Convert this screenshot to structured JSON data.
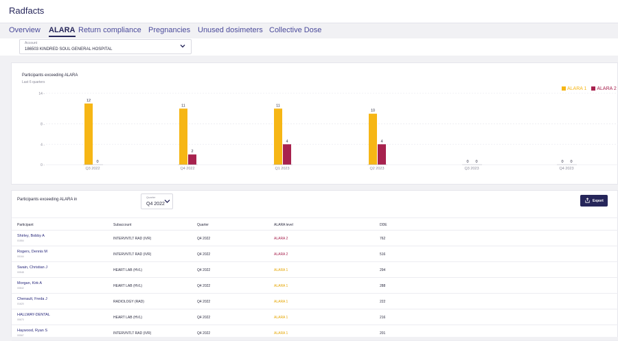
{
  "app": {
    "title": "Radfacts"
  },
  "tabs": [
    {
      "label": "Overview",
      "active": false
    },
    {
      "label": "ALARA",
      "active": true
    },
    {
      "label": "Return compliance",
      "active": false
    },
    {
      "label": "Pregnancies",
      "active": false
    },
    {
      "label": "Unused dosimeters",
      "active": false
    },
    {
      "label": "Collective Dose",
      "active": false
    }
  ],
  "account": {
    "caption": "Account",
    "value": "186503 KINDRED SOUL GENERAL HOSPITAL",
    "icon": "chevron-down-icon"
  },
  "chart_data": {
    "type": "bar",
    "title": "Participants exceeding ALARA",
    "subtitle": "Last 6 quarters",
    "categories": [
      "Q3 2022",
      "Q4 2022",
      "Q1 2023",
      "Q2 2023",
      "Q3 2023",
      "Q4 2023"
    ],
    "series": [
      {
        "name": "ALARA 1",
        "color": "#f6b615",
        "values": [
          12,
          11,
          11,
          10,
          0,
          0
        ]
      },
      {
        "name": "ALARA 2",
        "color": "#a7224e",
        "values": [
          0,
          2,
          4,
          4,
          0,
          0
        ]
      }
    ],
    "yticks": [
      0,
      4,
      8,
      14
    ],
    "ylim": [
      0,
      14
    ],
    "grid": true,
    "legend_position": "top-right"
  },
  "table": {
    "title": "Participants exceeding ALARA in",
    "quarter_caption": "Quarter",
    "quarter_value": "Q4 2022",
    "quarter_icon": "chevron-down-icon",
    "export_label": "Export",
    "export_icon": "upload-icon",
    "columns": [
      "Participant",
      "Subaccount",
      "Quarter",
      "ALARA level",
      "DDE"
    ],
    "rows": [
      {
        "name": "Shirley, Bobby A",
        "id": "01554",
        "subaccount": "INTERVNTLT RAD (IVR)",
        "quarter": "Q4 2022",
        "level": "ALARA 2",
        "dde": "762"
      },
      {
        "name": "Rogers, Dennis M",
        "id": "00164",
        "subaccount": "INTERVNTLT RAD (IVR)",
        "quarter": "Q4 2022",
        "level": "ALARA 2",
        "dde": "516"
      },
      {
        "name": "Swain, Christian J",
        "id": "00548",
        "subaccount": "HEART LAB (HVL)",
        "quarter": "Q4 2022",
        "level": "ALARA 1",
        "dde": "294"
      },
      {
        "name": "Morgan, Kirk A",
        "id": "00842",
        "subaccount": "HEART LAB (HVL)",
        "quarter": "Q4 2022",
        "level": "ALARA 1",
        "dde": "288"
      },
      {
        "name": "Chenault, Freda J",
        "id": "01620",
        "subaccount": "RADIOLOGY (RAD)",
        "quarter": "Q4 2022",
        "level": "ALARA 1",
        "dde": "222"
      },
      {
        "name": "HALLWAY-DENTAL",
        "id": "00670",
        "subaccount": "HEART LAB (HVL)",
        "quarter": "Q4 2022",
        "level": "ALARA 1",
        "dde": "216"
      },
      {
        "name": "Haywood, Ryan S",
        "id": "00567",
        "subaccount": "INTERVNTLT RAD (IVR)",
        "quarter": "Q4 2022",
        "level": "ALARA 1",
        "dde": "201"
      }
    ]
  }
}
